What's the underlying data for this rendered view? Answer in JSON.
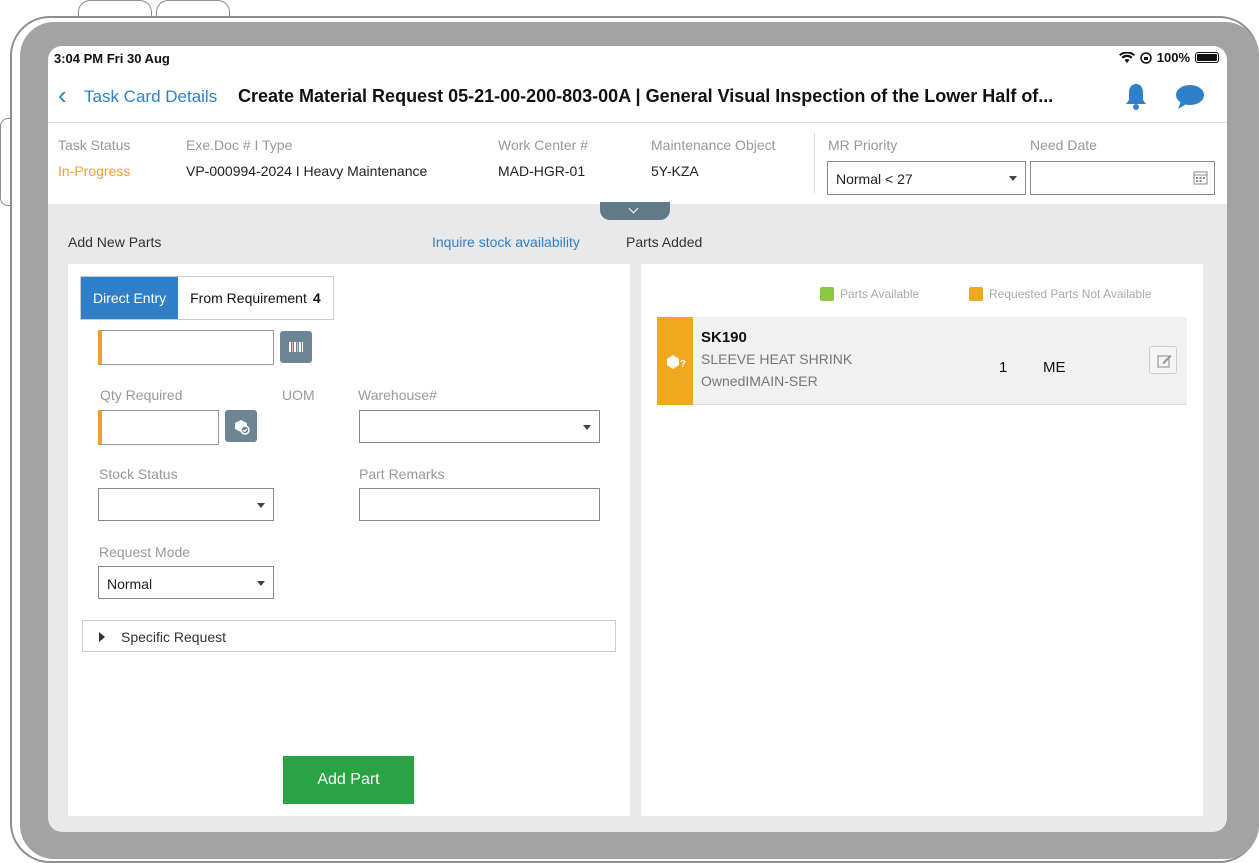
{
  "status_bar": {
    "time": "3:04 PM  Fri 30 Aug",
    "battery": "100%"
  },
  "nav": {
    "back_label": "Task Card Details",
    "title": "Create Material Request 05-21-00-200-803-00A | General Visual Inspection of the Lower Half of..."
  },
  "header": {
    "task_status_label": "Task Status",
    "task_status_value": "In-Progress",
    "exe_doc_label": "Exe.Doc # I Type",
    "exe_doc_value": "VP-000994-2024 I Heavy Maintenance",
    "work_center_label": "Work Center #",
    "work_center_value": "MAD-HGR-01",
    "maint_object_label": "Maintenance Object",
    "maint_object_value": "5Y-KZA",
    "mr_priority_label": "MR Priority",
    "mr_priority_value": "Normal < 27",
    "need_date_label": "Need Date",
    "need_date_value": ""
  },
  "add_parts": {
    "section_label": "Add New Parts",
    "inquire_link": "Inquire stock availability",
    "tabs": [
      {
        "label": "Direct Entry",
        "count": ""
      },
      {
        "label": "From Requirement",
        "count": "4"
      }
    ],
    "part_input_value": "",
    "qty_label": "Qty Required",
    "qty_value": "",
    "uom_label": "UOM",
    "warehouse_label": "Warehouse#",
    "warehouse_value": "",
    "stock_status_label": "Stock Status",
    "stock_status_value": "",
    "part_remarks_label": "Part Remarks",
    "part_remarks_value": "",
    "request_mode_label": "Request Mode",
    "request_mode_value": "Normal",
    "specific_request_label": "Specific Request",
    "add_button_label": "Add Part"
  },
  "parts_added": {
    "section_label": "Parts Added",
    "legend": [
      {
        "label": "Parts Available",
        "color": "#8dc63f"
      },
      {
        "label": "Requested Parts Not Available",
        "color": "#f0a81f"
      }
    ],
    "items": [
      {
        "part_no": "SK190",
        "description": "SLEEVE HEAT SHRINK",
        "ownership": "OwnedIMAIN-SER",
        "qty": "1",
        "uom": "ME",
        "status_color": "#f0a81f"
      }
    ]
  }
}
